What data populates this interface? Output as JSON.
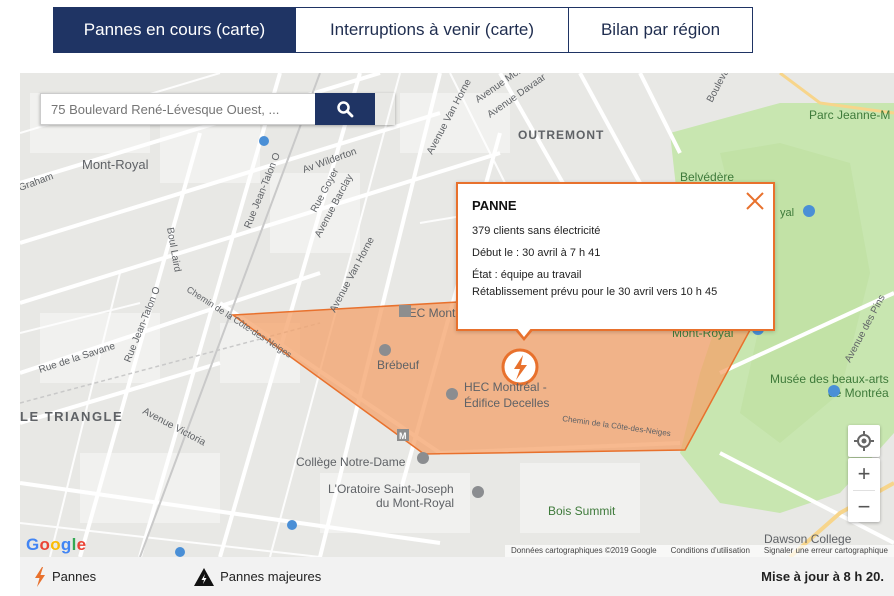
{
  "tabs": [
    {
      "label": "Pannes en cours (carte)",
      "active": true
    },
    {
      "label": "Interruptions à venir (carte)",
      "active": false
    },
    {
      "label": "Bilan par région",
      "active": false
    }
  ],
  "search": {
    "placeholder": "75 Boulevard René-Lévesque Ouest, ..."
  },
  "popup": {
    "title": "PANNE",
    "clients": "379 clients sans électricité",
    "start": "Début le : 30 avril à 7 h 41",
    "state": "État : équipe au travail",
    "restore": "Rétablissement prévu pour le 30 avril vers 10 h 45"
  },
  "map": {
    "labels": {
      "outremont": "OUTREMONT",
      "mont_royal": "Mont-Royal",
      "le_triangle": "LE TRIANGLE",
      "graham": "Graham",
      "wilderton": "Av Wilderton",
      "goyer": "Rue Goyer",
      "barclay": "Avenue Barclay",
      "van_horne1": "Avenue Van Horne",
      "van_horne2": "Avenue Van Horne",
      "jean_talon1": "Rue Jean-Talon O",
      "jean_talon2": "Rue Jean-Talon O",
      "laird": "Boul Laird",
      "savane": "Rue de la Savane",
      "victoria": "Avenue Victoria",
      "cote_neiges1": "Chemin de la Côte-des-Neiges",
      "cote_neiges2": "Chemin de la Côte-des-Neiges",
      "mceachran": "Avenue McEachran",
      "davaar": "Avenue Davaar",
      "bouleva": "Bouleva",
      "pins": "Avenue des Pins",
      "parc_jeanne": "Parc Jeanne-M",
      "belvedere": "Belvédère",
      "royal": "yal",
      "hec_montreal": "HEC Montré",
      "brebeuf": "Brébeuf",
      "hec_decelles1": "HEC Montréal -",
      "hec_decelles2": "Édifice Decelles",
      "college_nd": "Collège Notre-Dame",
      "oratoire1": "L'Oratoire Saint-Joseph",
      "oratoire2": "du Mont-Royal",
      "bois_summit": "Bois Summit",
      "mont_royal_park": "Mont-Royal",
      "musee1": "Musée des beaux-arts",
      "musee2": "de Montréa",
      "dawson": "Dawson College",
      "metro_m": "M"
    },
    "google_letters": [
      "G",
      "o",
      "o",
      "g",
      "l",
      "e"
    ],
    "google_colors": [
      "#4285f4",
      "#ea4335",
      "#fbbc05",
      "#4285f4",
      "#34a853",
      "#ea4335"
    ],
    "attribution": {
      "data": "Données cartographiques ©2019 Google",
      "terms": "Conditions d'utilisation",
      "report": "Signaler une erreur cartographique"
    },
    "zoom_in": "+",
    "zoom_out": "−"
  },
  "legend": {
    "outages": "Pannes",
    "major": "Pannes majeures",
    "update": "Mise à jour à 8 h 20."
  },
  "colors": {
    "navy": "#1f3464",
    "outage_orange": "#e8712d",
    "outage_fill": "#f4a26a",
    "park_green": "#c8e6b0"
  }
}
